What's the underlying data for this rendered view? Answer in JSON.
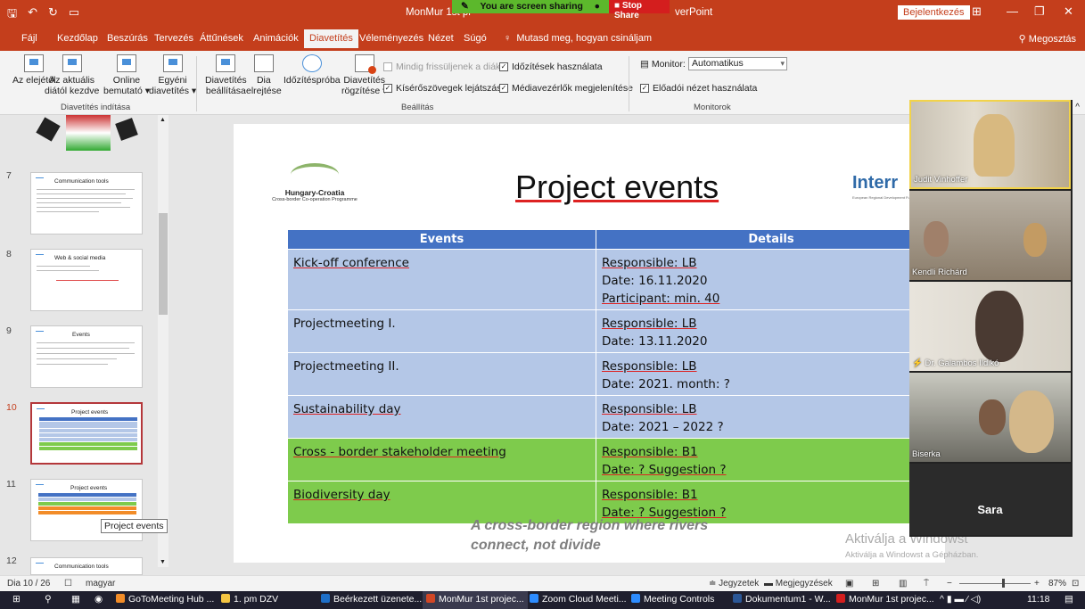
{
  "titlebar": {
    "title_left": "MonMur 1st pr",
    "title_right": "verPoint",
    "screen_sharing": "You are screen sharing",
    "stop_share": "Stop Share",
    "login": "Bejelentkezés"
  },
  "tabs": [
    "Fájl",
    "Kezdőlap",
    "Beszúrás",
    "Tervezés",
    "Áttűnések",
    "Animációk",
    "Diavetítés",
    "Véleményezés",
    "Nézet",
    "Súgó"
  ],
  "active_tab": "Diavetítés",
  "tell_me": "Mutasd meg, hogyan csináljam",
  "share": "Megosztás",
  "ribbon": {
    "start": {
      "from_start": "Az elejétől",
      "from_current_1": "Az aktuális",
      "from_current_2": "diától kezdve",
      "online_1": "Online",
      "online_2": "bemutató ▾",
      "custom_1": "Egyéni",
      "custom_2": "diavetítés ▾",
      "group": "Diavetítés indítása"
    },
    "setup": {
      "setup_1": "Diavetítés",
      "setup_2": "beállítása",
      "hide_1": "Dia",
      "hide_2": "elrejtése",
      "rehearse": "Időzítéspróba",
      "record_1": "Diavetítés",
      "record_2": "rögzítése ▾",
      "always_update": "Mindig frissüljenek a diák",
      "use_timings": "Időzítések használata",
      "play_narrations": "Kísérőszövegek lejátszása",
      "show_media": "Médiavezérlők megjelenítése",
      "group": "Beállítás"
    },
    "monitors": {
      "monitor_label": "Monitor:",
      "monitor_value": "Automatikus",
      "presenter_view": "Előadói nézet használata",
      "group": "Monitorok"
    }
  },
  "thumbnails": [
    {
      "num": "7",
      "title": "Communication tools"
    },
    {
      "num": "8",
      "title": "Web & social media"
    },
    {
      "num": "9",
      "title": "Events"
    },
    {
      "num": "10",
      "title": "Project events"
    },
    {
      "num": "11",
      "title": "Project events"
    },
    {
      "num": "12",
      "title": "Communication tools"
    }
  ],
  "tooltip": "Project events",
  "slide": {
    "title": "Project events",
    "logo_name": "Hungary-Croatia",
    "logo_sub": "Cross-border Co-operation Programme",
    "interreg": "Interr",
    "interreg_sub": "European Regional Development Fund",
    "headers": [
      "Events",
      "Details"
    ],
    "rows": [
      {
        "event": "Kick-off conference",
        "details": [
          "Responsible: LB",
          "Date: 16.11.2020",
          "Participant: min. 40"
        ]
      },
      {
        "event": "Projectmeeting I.",
        "details": [
          "Responsible: LB",
          "Date: 13.11.2020"
        ]
      },
      {
        "event": "Projectmeeting II.",
        "details": [
          "Responsible: LB",
          "Date: 2021. month: ?"
        ]
      },
      {
        "event": "Sustainability day",
        "details": [
          "Responsible: LB",
          "Date: 2021 – 2022 ?"
        ]
      },
      {
        "event": "Cross - border stakeholder meeting",
        "details": [
          "Responsible: B1",
          "Date: ? Suggestion ?"
        ]
      },
      {
        "event": "Biodiversity day",
        "details": [
          "Responsible: B1",
          "Date: ? Suggestion ?"
        ]
      }
    ],
    "footer_1": "A cross-border region where rivers",
    "footer_2": "connect, not divide"
  },
  "watermark": {
    "line1": "Aktiválja a Windowst",
    "line2": "Aktiválja a Windowst a Gépházban."
  },
  "participants": [
    "Judit Vinhoffer",
    "Kendli Richárd",
    "Dr. Galambos Ildikó",
    "Biserka",
    "Sara"
  ],
  "statusbar": {
    "slide": "Dia 10 / 26",
    "lang": "magyar",
    "notes": "Jegyzetek",
    "comments": "Megjegyzések",
    "zoom": "87%"
  },
  "taskbar": {
    "items": [
      "GoToMeeting Hub ...",
      "1. pm DZV",
      "Beérkezett üzenete...",
      "MonMur 1st projec...",
      "Zoom Cloud Meeti...",
      "Meeting Controls",
      "Dokumentum1 - W...",
      "MonMur 1st projec..."
    ],
    "clock": "11:18"
  }
}
